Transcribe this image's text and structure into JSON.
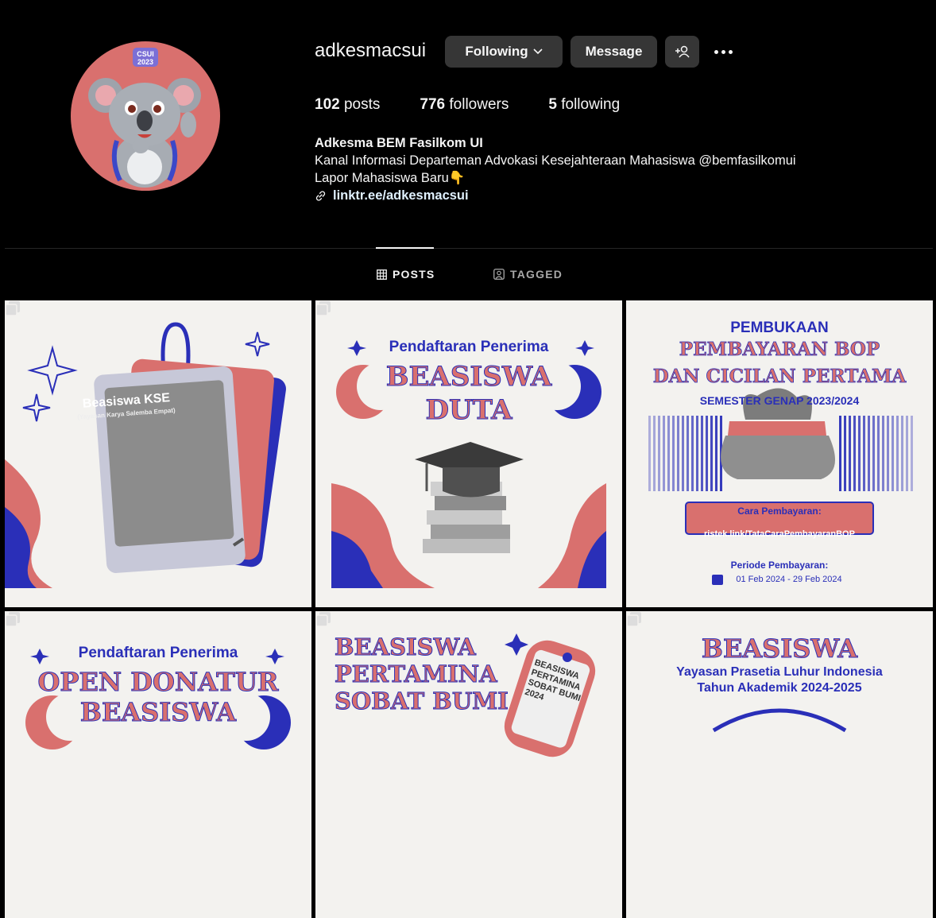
{
  "profile": {
    "username": "adkesmacsui",
    "avatar_badge_line1": "CSUI",
    "avatar_badge_line2": "2023",
    "buttons": {
      "following": "Following",
      "message": "Message"
    },
    "stats": {
      "posts_count": "102",
      "posts_label": "posts",
      "followers_count": "776",
      "followers_label": "followers",
      "following_count": "5",
      "following_label": "following"
    },
    "bio": {
      "name": "Adkesma BEM Fasilkom UI",
      "line1": "Kanal Informasi Departeman Advokasi Kesejahteraan Mahasiswa @bemfasilkomui",
      "line2": "Lapor Mahasiswa Baru👇",
      "link": "linktr.ee/adkesmacsui"
    }
  },
  "tabs": {
    "posts": "POSTS",
    "tagged": "TAGGED"
  },
  "posts": [
    {
      "title": "Beasiswa KSE",
      "subtitle": "(Yayasan Karya Salemba Empat)"
    },
    {
      "line1": "Pendaftaran Penerima",
      "line2": "BEASISWA",
      "line3": "DUTA"
    },
    {
      "line1": "PEMBUKAAN",
      "line2": "PEMBAYARAN BOP",
      "line3": "DAN CICILAN PERTAMA",
      "line4": "SEMESTER GENAP 2023/2024",
      "cara": "Cara Pembayaran:",
      "link": "ristek.link/TataCaraPembayaranBOP",
      "periode": "Periode Pembayaran:",
      "dates": "01 Feb 2024 - 29 Feb 2024"
    },
    {
      "line1": "Pendaftaran Penerima",
      "line2": "OPEN DONATUR",
      "line3": "BEASISWA"
    },
    {
      "line1": "BEASISWA",
      "line2": "PERTAMINA",
      "line3": "SOBAT BUMI",
      "card1": "BEASISWA",
      "card2": "PERTAMINA",
      "card3": "SOBAT BUMI",
      "card4": "2024"
    },
    {
      "line1": "BEASISWA",
      "line2": "Yayasan Prasetia Luhur Indonesia",
      "line3": "Tahun Akademik 2024-2025"
    }
  ],
  "colors": {
    "accent_blue": "#2a2fb8",
    "accent_red": "#d9706e",
    "button_bg": "#363636"
  }
}
